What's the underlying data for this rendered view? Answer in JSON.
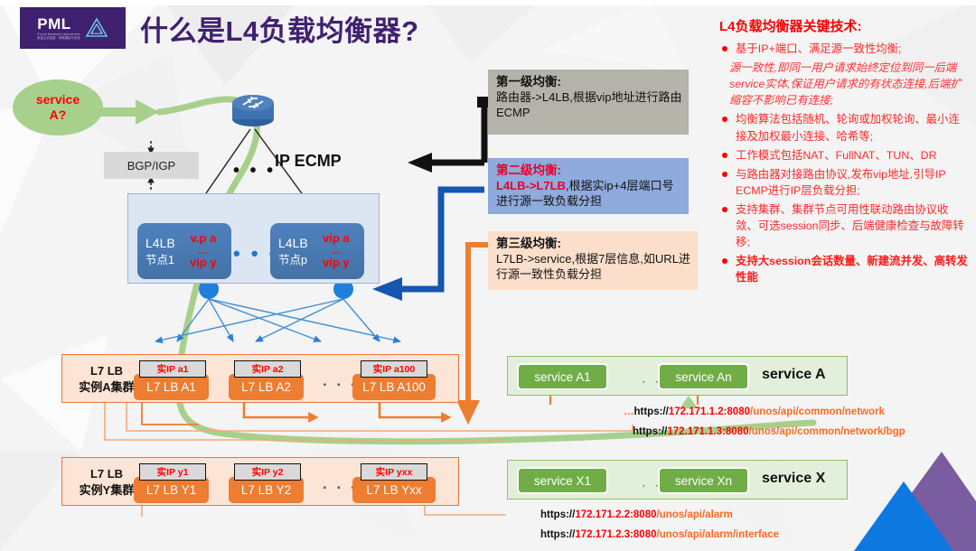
{
  "header": {
    "logo_main": "PML",
    "logo_sub": "Purple Mountain Laboratories",
    "logo_sub2": "紫金山实验室 · 网络通信与安全",
    "title": "什么是L4负载均衡器?"
  },
  "left": {
    "bubble_label": "service\nA?",
    "bgp_label": "BGP/IGP",
    "ip_ecmp_label": "IP ECMP",
    "router_icon": "router-icon",
    "ellipsis": "• • •"
  },
  "l4_cluster": {
    "nodes": [
      {
        "name": "L4LB",
        "node": "节点1",
        "vip_top": "v.p a",
        "vip_mid": "…",
        "vip_bottom": "vip y"
      },
      {
        "name": "L4LB",
        "node": "节点p",
        "vip_top": "vip a",
        "vip_mid": "…",
        "vip_bottom": "vip y"
      }
    ],
    "ellipsis": "• • •"
  },
  "l7_clusters": [
    {
      "label": "L7 LB\n实例A集群",
      "ellipsis": ". . .",
      "nodes": [
        {
          "tag": "实IP a1",
          "name": "L7 LB A1"
        },
        {
          "tag": "实IP a2",
          "name": "L7 LB A2"
        },
        {
          "tag": "实IP a100",
          "name": "L7 LB A100"
        }
      ]
    },
    {
      "label": "L7 LB\n实例Y集群",
      "ellipsis": ". . .",
      "nodes": [
        {
          "tag": "实IP y1",
          "name": "L7 LB Y1"
        },
        {
          "tag": "实IP y2",
          "name": "L7 LB Y2"
        },
        {
          "tag": "实IP yxx",
          "name": "L7 LB Yxx"
        }
      ]
    }
  ],
  "services": [
    {
      "title": "service A",
      "ellipsis": ". . .",
      "nodes": [
        "service A1",
        "service An"
      ],
      "urls": [
        {
          "lead": "…",
          "p1": "https://",
          "ip": "172.171.1.2:8080",
          "p2": "/unos/api/common/network"
        },
        {
          "lead": "",
          "p1": "https://",
          "ip": "172.171.1.3:8080",
          "p2": "/unos/api/common/network/bgp"
        }
      ]
    },
    {
      "title": "service X",
      "ellipsis": ". . .",
      "nodes": [
        "service X1",
        "service Xn"
      ],
      "urls": [
        {
          "lead": "",
          "p1": "https://",
          "ip": "172.171.2.2:8080",
          "p2": "/unos/api/alarm"
        },
        {
          "lead": "",
          "p1": "https://",
          "ip": "172.171.2.3:8080",
          "p2": "/unos/api/alarm/interface"
        }
      ]
    }
  ],
  "callouts": [
    {
      "title": "第一级均衡:",
      "body_plain": "路由器->L4LB,根据vip地址进行路由ECMP",
      "bg": "#b3b3a9"
    },
    {
      "title": "第二级均衡:",
      "body_highlight": "L4LB->L7LB",
      "body_rest": ",根据实ip+4层端口号进行源一致负载分担",
      "bg": "#8faadc"
    },
    {
      "title": "第三级均衡:",
      "body_plain": "L7LB->service,根据7层信息,如URL进行源一致性负载分担",
      "bg": "#fbdfcb"
    }
  ],
  "panel": {
    "title": "L4负载均衡器关键技术:",
    "bullets": [
      {
        "style": "normal",
        "dot": true,
        "text": "基于IP+端口、满足源一致性均衡;"
      },
      {
        "style": "italic",
        "dot": false,
        "text": "源一致性,即同一用户请求始终定位到同一后端service实体,保证用户请求的有状态连接,后端扩缩容不影响已有连接;"
      },
      {
        "style": "normal",
        "dot": true,
        "text": "均衡算法包括随机、轮询或加权轮询、最小连接及加权最小连接、哈希等;"
      },
      {
        "style": "normal",
        "dot": true,
        "text": "工作模式包括NAT、FullNAT、TUN、DR"
      },
      {
        "style": "normal",
        "dot": true,
        "text": "与路由器对接路由协议,发布vip地址,引导IP ECMP进行IP层负载分担;"
      },
      {
        "style": "normal",
        "dot": true,
        "text": "支持集群、集群节点可用性联动路由协议收敛、可选session同步、后端健康检查与故障转移;"
      },
      {
        "style": "bold",
        "dot": true,
        "text": "支持大session会话数量、新建流并发、高转发性能"
      }
    ]
  },
  "colors": {
    "brand_purple": "#3f2170",
    "accent_red": "#f00",
    "l4_blue": "#4f81bd",
    "l7_orange": "#ed7d31",
    "service_green": "#70ad47",
    "flow_green": "#a8d08d",
    "arrow_blue": "#1f6fc4"
  }
}
